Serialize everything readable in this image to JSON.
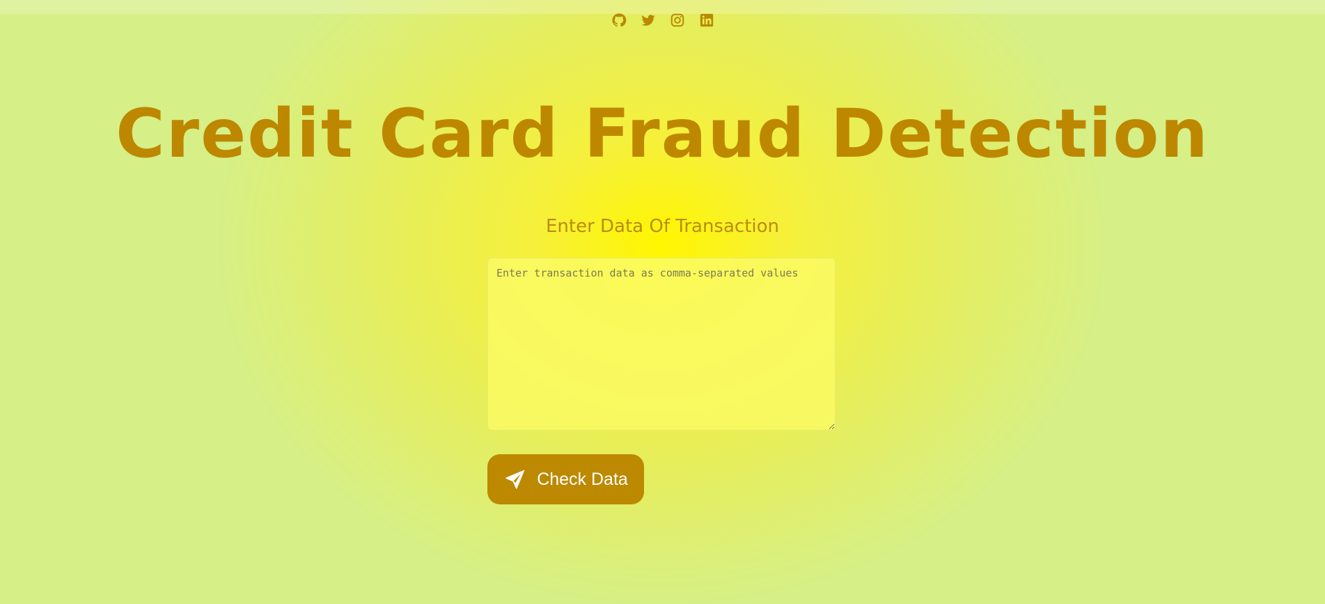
{
  "social": [
    {
      "name": "github"
    },
    {
      "name": "twitter"
    },
    {
      "name": "instagram"
    },
    {
      "name": "linkedin"
    }
  ],
  "header": {
    "title": "Credit Card Fraud Detection",
    "subtitle": "Enter Data Of Transaction"
  },
  "form": {
    "placeholder": "Enter transaction data as comma-separated values",
    "value": "",
    "submit_label": "Check Data",
    "submit_icon": "paper-plane-icon"
  },
  "colors": {
    "accent": "#bd8900",
    "title": "#bd8800",
    "background_center": "#fff600",
    "background_edge": "#d6ef86"
  }
}
